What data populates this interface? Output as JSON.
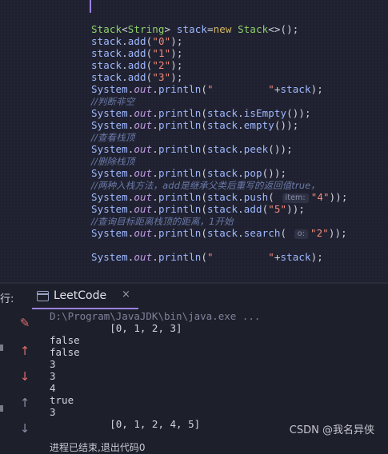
{
  "editor": {
    "lines": [
      {
        "parts": [
          [
            "c-type",
            "Stack"
          ],
          [
            "c-punc",
            "<"
          ],
          [
            "c-type",
            "String"
          ],
          [
            "c-punc",
            "> "
          ],
          [
            "c-id",
            "stack"
          ],
          [
            "c-punc",
            "="
          ],
          [
            "c-kw",
            "new "
          ],
          [
            "c-type",
            "Stack"
          ],
          [
            "c-punc",
            "<>();"
          ]
        ]
      },
      {
        "parts": [
          [
            "c-id",
            "stack"
          ],
          [
            "c-punc",
            "."
          ],
          [
            "c-sys",
            "add"
          ],
          [
            "c-punc",
            "("
          ],
          [
            "c-str",
            "\"0\""
          ],
          [
            "c-punc",
            ");"
          ]
        ]
      },
      {
        "parts": [
          [
            "c-id",
            "stack"
          ],
          [
            "c-punc",
            "."
          ],
          [
            "c-sys",
            "add"
          ],
          [
            "c-punc",
            "("
          ],
          [
            "c-str",
            "\"1\""
          ],
          [
            "c-punc",
            ");"
          ]
        ]
      },
      {
        "parts": [
          [
            "c-id",
            "stack"
          ],
          [
            "c-punc",
            "."
          ],
          [
            "c-sys",
            "add"
          ],
          [
            "c-punc",
            "("
          ],
          [
            "c-str",
            "\"2\""
          ],
          [
            "c-punc",
            ");"
          ]
        ]
      },
      {
        "parts": [
          [
            "c-id",
            "stack"
          ],
          [
            "c-punc",
            "."
          ],
          [
            "c-sys",
            "add"
          ],
          [
            "c-punc",
            "("
          ],
          [
            "c-str",
            "\"3\""
          ],
          [
            "c-punc",
            ");"
          ]
        ]
      },
      {
        "parts": [
          [
            "c-sys",
            "System"
          ],
          [
            "c-punc",
            "."
          ],
          [
            "c-field",
            "out"
          ],
          [
            "c-punc",
            "."
          ],
          [
            "c-sys",
            "println"
          ],
          [
            "c-punc",
            "("
          ],
          [
            "c-str",
            "\"         \""
          ],
          [
            "c-punc",
            "+"
          ],
          [
            "c-id",
            "stack"
          ],
          [
            "c-punc",
            ");"
          ]
        ]
      },
      {
        "parts": [
          [
            "c-com",
            "//判断非空"
          ]
        ]
      },
      {
        "parts": [
          [
            "c-sys",
            "System"
          ],
          [
            "c-punc",
            "."
          ],
          [
            "c-field",
            "out"
          ],
          [
            "c-punc",
            "."
          ],
          [
            "c-sys",
            "println"
          ],
          [
            "c-punc",
            "("
          ],
          [
            "c-id",
            "stack"
          ],
          [
            "c-punc",
            "."
          ],
          [
            "c-sys",
            "isEmpty"
          ],
          [
            "c-punc",
            "());"
          ]
        ]
      },
      {
        "parts": [
          [
            "c-sys",
            "System"
          ],
          [
            "c-punc",
            "."
          ],
          [
            "c-field",
            "out"
          ],
          [
            "c-punc",
            "."
          ],
          [
            "c-sys",
            "println"
          ],
          [
            "c-punc",
            "("
          ],
          [
            "c-id",
            "stack"
          ],
          [
            "c-punc",
            "."
          ],
          [
            "c-sys",
            "empty"
          ],
          [
            "c-punc",
            "());"
          ]
        ]
      },
      {
        "parts": [
          [
            "c-com",
            "//查看栈顶"
          ]
        ]
      },
      {
        "parts": [
          [
            "c-sys",
            "System"
          ],
          [
            "c-punc",
            "."
          ],
          [
            "c-field",
            "out"
          ],
          [
            "c-punc",
            "."
          ],
          [
            "c-sys",
            "println"
          ],
          [
            "c-punc",
            "("
          ],
          [
            "c-id",
            "stack"
          ],
          [
            "c-punc",
            "."
          ],
          [
            "c-sys",
            "peek"
          ],
          [
            "c-punc",
            "());"
          ]
        ]
      },
      {
        "parts": [
          [
            "c-com",
            "//删除栈顶"
          ]
        ]
      },
      {
        "parts": [
          [
            "c-sys",
            "System"
          ],
          [
            "c-punc",
            "."
          ],
          [
            "c-field",
            "out"
          ],
          [
            "c-punc",
            "."
          ],
          [
            "c-sys",
            "println"
          ],
          [
            "c-punc",
            "("
          ],
          [
            "c-id",
            "stack"
          ],
          [
            "c-punc",
            "."
          ],
          [
            "c-sys",
            "pop"
          ],
          [
            "c-punc",
            "());"
          ]
        ]
      },
      {
        "parts": [
          [
            "c-com",
            "//两种入栈方法，add是继承父类后重写的返回值true，"
          ]
        ]
      },
      {
        "parts": [
          [
            "c-sys",
            "System"
          ],
          [
            "c-punc",
            "."
          ],
          [
            "c-field",
            "out"
          ],
          [
            "c-punc",
            "."
          ],
          [
            "c-sys",
            "println"
          ],
          [
            "c-punc",
            "("
          ],
          [
            "c-id",
            "stack"
          ],
          [
            "c-punc",
            "."
          ],
          [
            "c-sys",
            "push"
          ],
          [
            "c-punc",
            "( "
          ],
          [
            "hint",
            "item:"
          ],
          [
            "c-str",
            "\"4\""
          ],
          [
            "c-punc",
            "));"
          ]
        ]
      },
      {
        "parts": [
          [
            "c-sys",
            "System"
          ],
          [
            "c-punc",
            "."
          ],
          [
            "c-field",
            "out"
          ],
          [
            "c-punc",
            "."
          ],
          [
            "c-sys",
            "println"
          ],
          [
            "c-punc",
            "("
          ],
          [
            "c-id",
            "stack"
          ],
          [
            "c-punc",
            "."
          ],
          [
            "c-sys",
            "add"
          ],
          [
            "c-punc",
            "("
          ],
          [
            "c-str",
            "\"5\""
          ],
          [
            "c-punc",
            "));"
          ]
        ]
      },
      {
        "parts": [
          [
            "c-com",
            "//查询目标距离栈顶的距离，1开始"
          ]
        ]
      },
      {
        "parts": [
          [
            "c-sys",
            "System"
          ],
          [
            "c-punc",
            "."
          ],
          [
            "c-field",
            "out"
          ],
          [
            "c-punc",
            "."
          ],
          [
            "c-sys",
            "println"
          ],
          [
            "c-punc",
            "("
          ],
          [
            "c-id",
            "stack"
          ],
          [
            "c-punc",
            "."
          ],
          [
            "c-sys",
            "search"
          ],
          [
            "c-punc",
            "( "
          ],
          [
            "hint",
            "o:"
          ],
          [
            "c-str",
            "\"2\""
          ],
          [
            "c-punc",
            "));"
          ]
        ]
      },
      {
        "parts": []
      },
      {
        "parts": [
          [
            "c-sys",
            "System"
          ],
          [
            "c-punc",
            "."
          ],
          [
            "c-field",
            "out"
          ],
          [
            "c-punc",
            "."
          ],
          [
            "c-sys",
            "println"
          ],
          [
            "c-punc",
            "("
          ],
          [
            "c-str",
            "\"         \""
          ],
          [
            "c-punc",
            "+"
          ],
          [
            "c-id",
            "stack"
          ],
          [
            "c-punc",
            ");"
          ]
        ]
      }
    ]
  },
  "runbar": {
    "label": "行:",
    "tab_label": "LeetCode",
    "tab_close": "×"
  },
  "console": {
    "lines": [
      {
        "text": "D:\\Program\\JavaJDK\\bin\\java.exe ...",
        "cls": "path"
      },
      {
        "text": "          [0, 1, 2, 3]",
        "cls": ""
      },
      {
        "text": "false",
        "cls": ""
      },
      {
        "text": "false",
        "cls": ""
      },
      {
        "text": "3",
        "cls": ""
      },
      {
        "text": "3",
        "cls": ""
      },
      {
        "text": "4",
        "cls": ""
      },
      {
        "text": "true",
        "cls": ""
      },
      {
        "text": "3",
        "cls": ""
      },
      {
        "text": "          [0, 1, 2, 4, 5]",
        "cls": ""
      },
      {
        "text": "",
        "cls": ""
      },
      {
        "text": "进程已结束,退出代码0",
        "cls": "exit"
      }
    ],
    "tools": [
      {
        "name": "clear-output-icon",
        "glyph": "✎",
        "color": "#e06c6c"
      },
      {
        "name": "scroll-up-icon",
        "glyph": "↑",
        "color": "#e06c6c"
      },
      {
        "name": "scroll-down-icon",
        "glyph": "↓",
        "color": "#e06c6c"
      },
      {
        "name": "up-arrow-icon",
        "glyph": "↑",
        "color": "#8a8ea6"
      },
      {
        "name": "down-arrow-icon",
        "glyph": "↓",
        "color": "#8a8ea6"
      }
    ]
  },
  "watermark": "CSDN @我名异侠"
}
